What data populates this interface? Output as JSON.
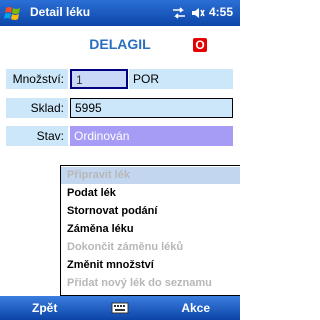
{
  "titlebar": {
    "title": "Detail léku",
    "time": "4:55"
  },
  "header": {
    "drug_name": "DELAGIL",
    "badge": "O"
  },
  "form": {
    "quantity_label": "Množství:",
    "quantity_value": "1",
    "unit": "POR",
    "warehouse_label": "Sklad:",
    "warehouse_value": "5995",
    "status_label": "Stav:",
    "status_value": "Ordinován"
  },
  "menu": {
    "items": [
      {
        "label": "Připravit lék",
        "enabled": false,
        "selected": true
      },
      {
        "label": "Podat lék",
        "enabled": true
      },
      {
        "label": "Stornovat podání",
        "enabled": true
      },
      {
        "label": "Záměna léku",
        "enabled": true
      },
      {
        "label": "Dokončit záměnu léků",
        "enabled": false
      },
      {
        "label": "Změnit množství",
        "enabled": true
      },
      {
        "label": "Přidat nový lék do seznamu",
        "enabled": false
      }
    ]
  },
  "softkeys": {
    "left": "Zpět",
    "right": "Akce"
  },
  "colors": {
    "accent": "#2a6fc2",
    "badge": "#e40000",
    "label_bg": "#cce7f9",
    "status_bg": "#a69cf5"
  }
}
